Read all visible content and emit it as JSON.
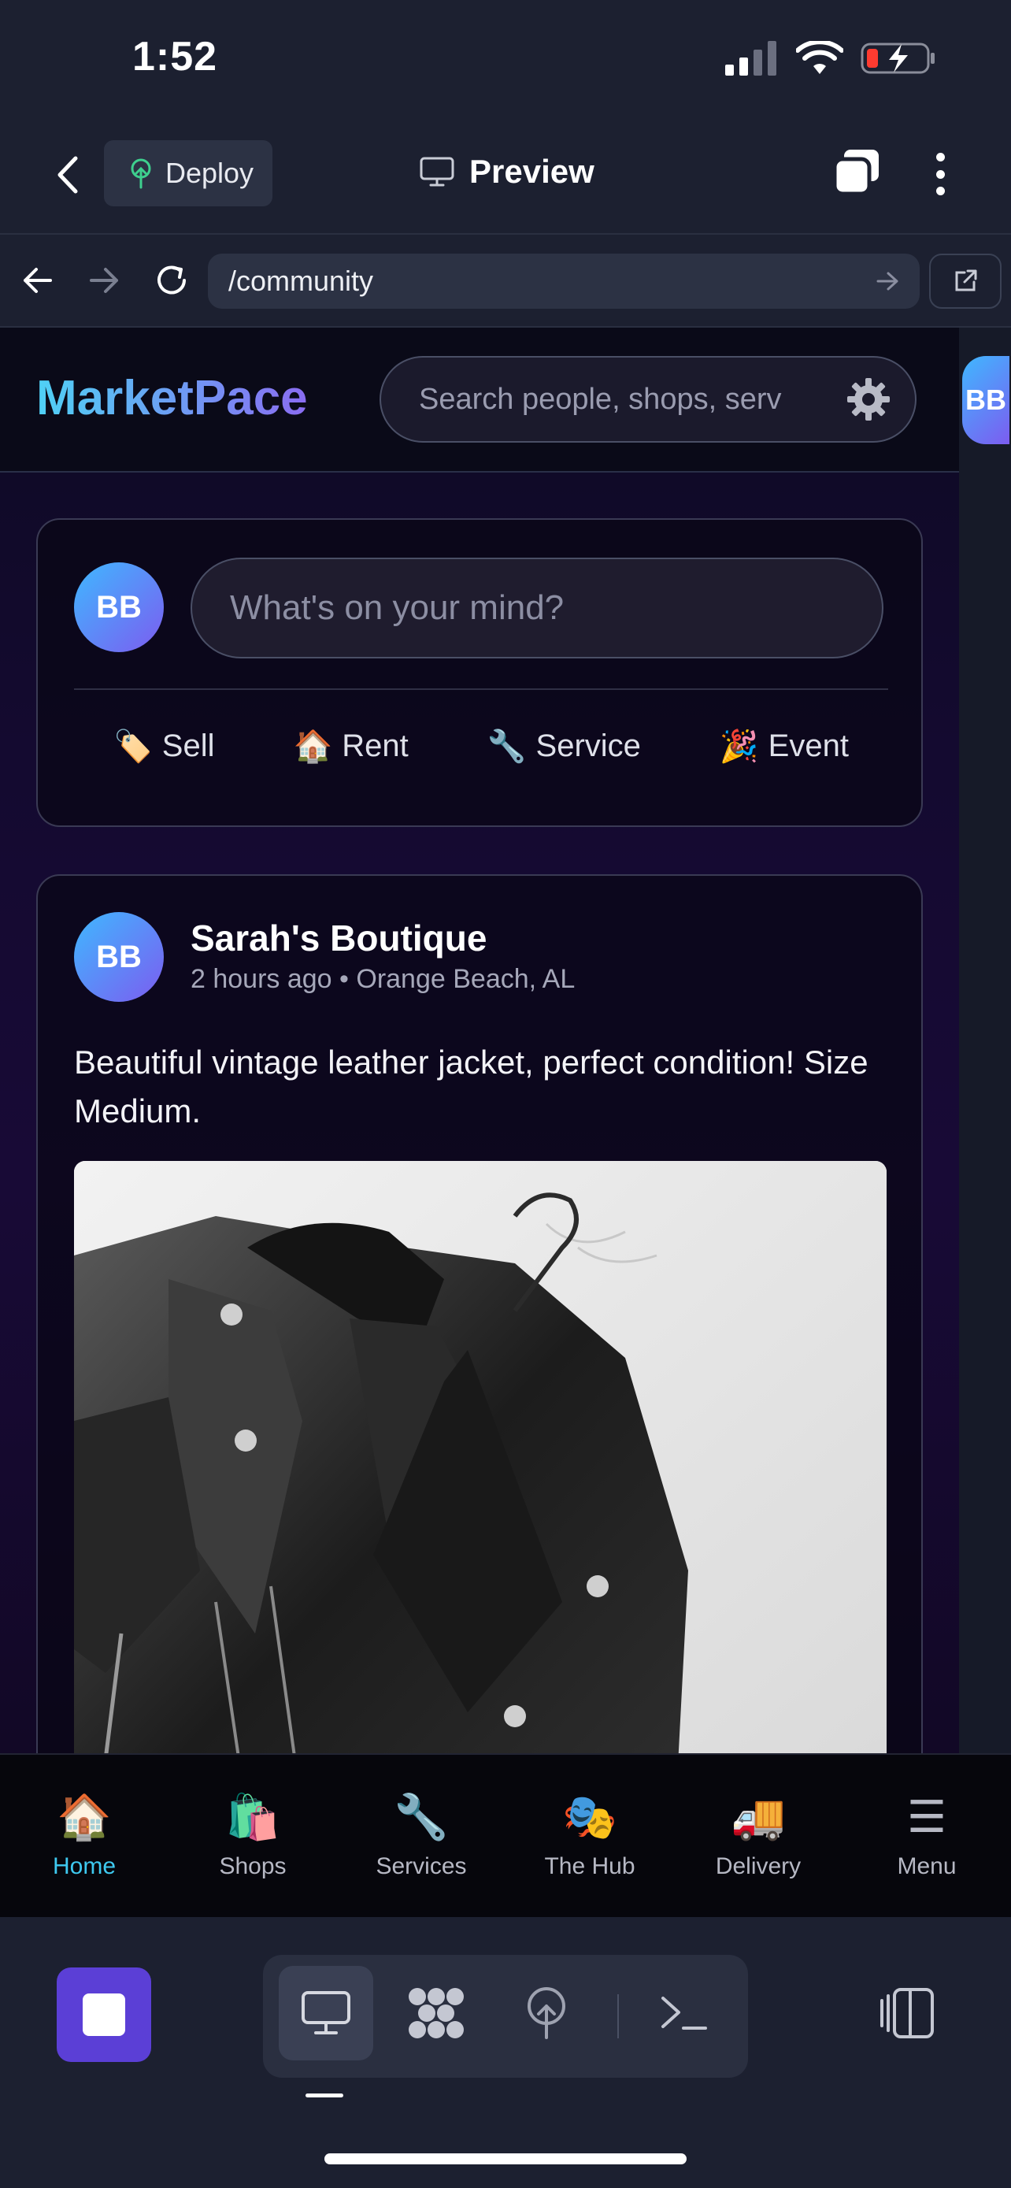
{
  "status_bar": {
    "time": "1:52"
  },
  "toolbar": {
    "deploy_label": "Deploy",
    "preview_label": "Preview"
  },
  "browser": {
    "url": "/community"
  },
  "site": {
    "logo": "MarketPace",
    "search_placeholder": "Search people, shops, serv",
    "user_initials": "BB"
  },
  "composer": {
    "avatar_initials": "BB",
    "placeholder": "What's on your mind?",
    "actions": [
      {
        "icon": "🏷️",
        "label": "Sell"
      },
      {
        "icon": "🏠",
        "label": "Rent"
      },
      {
        "icon": "🔧",
        "label": "Service"
      },
      {
        "icon": "🎉",
        "label": "Event"
      }
    ]
  },
  "post": {
    "avatar_initials": "BB",
    "author": "Sarah's Boutique",
    "meta": "2 hours ago • Orange Beach, AL",
    "text": "Beautiful vintage leather jacket, perfect condition! Size Medium."
  },
  "bottom_nav": [
    {
      "icon": "🏠",
      "label": "Home",
      "active": true
    },
    {
      "icon": "🛍️",
      "label": "Shops"
    },
    {
      "icon": "🔧",
      "label": "Services"
    },
    {
      "icon": "🎭",
      "label": "The Hub"
    },
    {
      "icon": "🚚",
      "label": "Delivery"
    },
    {
      "icon": "☰",
      "label": "Menu"
    }
  ],
  "colors": {
    "accent": "#3ec9f0",
    "stop_button": "#5b3fd6",
    "logo_gradient_start": "#4fd1f5",
    "logo_gradient_end": "#8a6cf2"
  }
}
